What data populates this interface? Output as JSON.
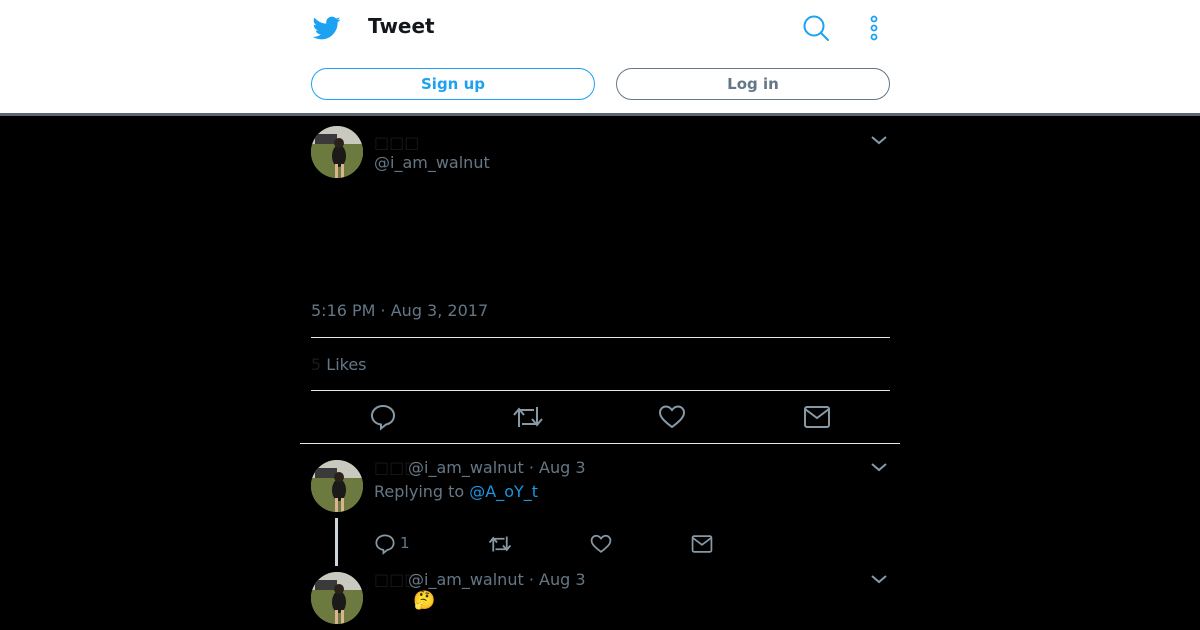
{
  "header": {
    "title": "Tweet",
    "signup_label": "Sign up",
    "login_label": "Log in",
    "icons": [
      "twitter-bird-icon",
      "search-icon",
      "more-vertical-icon"
    ]
  },
  "tweet": {
    "display_name": "□□□",
    "handle": "@i_am_walnut",
    "timestamp": "5:16 PM · Aug 3, 2017",
    "likes_count": "5",
    "likes_label": "Likes"
  },
  "replies": [
    {
      "display_name": "□□□",
      "handle": "@i_am_walnut",
      "date": "· Aug 3",
      "replying_prefix": "Replying to",
      "replying_to": "@A_oY_t",
      "reply_count": "1"
    },
    {
      "display_name": "□□□",
      "handle": "@i_am_walnut",
      "date": "· Aug 3",
      "text": "🤔"
    }
  ],
  "colors": {
    "brand": "#1da1f2",
    "muted": "#657786",
    "background": "#000000"
  }
}
